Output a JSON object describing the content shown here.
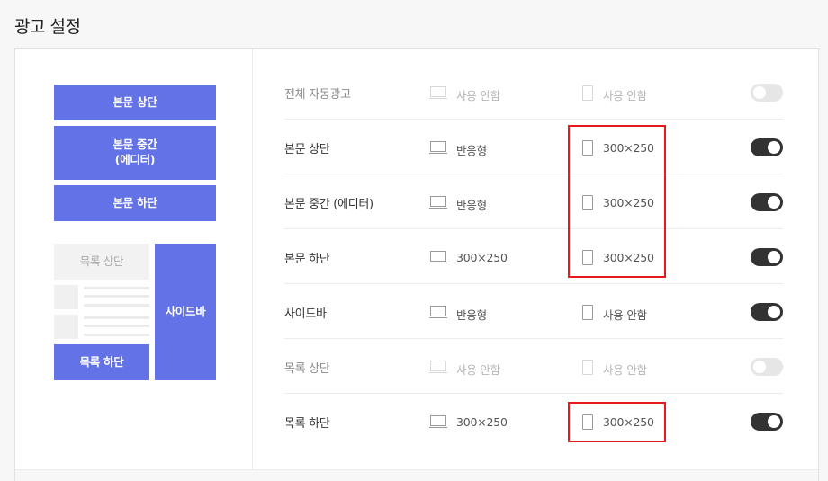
{
  "page": {
    "title": "광고 설정"
  },
  "preview": {
    "body_top": "본문 상단",
    "body_middle_line1": "본문 중간",
    "body_middle_line2": "(에디터)",
    "body_bottom": "본문 하단",
    "list_top": "목록 상단",
    "sidebar": "사이드바",
    "list_bottom": "목록 하단"
  },
  "rows": [
    {
      "name": "전체 자동광고",
      "pc": "사용 안함",
      "mobile": "사용 안함",
      "enabled": false
    },
    {
      "name": "본문 상단",
      "pc": "반응형",
      "mobile": "300×250",
      "enabled": true
    },
    {
      "name": "본문 중간 (에디터)",
      "pc": "반응형",
      "mobile": "300×250",
      "enabled": true
    },
    {
      "name": "본문 하단",
      "pc": "300×250",
      "mobile": "300×250",
      "enabled": true
    },
    {
      "name": "사이드바",
      "pc": "반응형",
      "mobile": "사용 안함",
      "enabled": true
    },
    {
      "name": "목록 상단",
      "pc": "사용 안함",
      "mobile": "사용 안함",
      "enabled": false
    },
    {
      "name": "목록 하단",
      "pc": "300×250",
      "mobile": "300×250",
      "enabled": true
    }
  ],
  "colors": {
    "accent": "#6372e6",
    "toggle_on": "#333333",
    "highlight": "#e8191c"
  }
}
